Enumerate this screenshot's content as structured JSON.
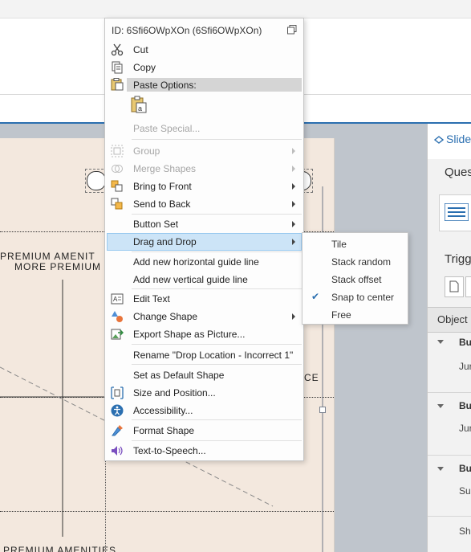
{
  "slide": {
    "text_premium_1": "PREMIUM AMENIT",
    "text_premium_2": "MORE PREMIUM",
    "text_ce": "CE",
    "text_premium_bottom": "PREMIUM AMENITIES"
  },
  "right_panel": {
    "slide_tab": "Slide",
    "question_label": "Ques",
    "triggers_label": "Trigg",
    "object_label": "Object",
    "bu_1": "Bu",
    "ju_1": "Jur",
    "bu_2": "Bu",
    "ju_2": "Jur",
    "bu_3": "Bu",
    "sub_1": "Sub",
    "sho_1": "Sho"
  },
  "context_menu": {
    "id_label": "ID: 6Sfi6OWpXOn  (6Sfi6OWpXOn)",
    "cut": "Cut",
    "copy": "Copy",
    "paste_options": "Paste Options:",
    "paste_special": "Paste Special...",
    "group": "Group",
    "merge_shapes": "Merge Shapes",
    "bring_to_front": "Bring to Front",
    "send_to_back": "Send to Back",
    "button_set": "Button Set",
    "drag_and_drop": "Drag and Drop",
    "add_h_guide": "Add new horizontal guide line",
    "add_v_guide": "Add new vertical guide line",
    "edit_text": "Edit Text",
    "change_shape": "Change Shape",
    "export_shape": "Export Shape as Picture...",
    "rename": "Rename \"Drop Location - Incorrect 1\"",
    "set_default": "Set as Default Shape",
    "size_position": "Size and Position...",
    "accessibility": "Accessibility...",
    "format_shape": "Format Shape",
    "tts": "Text-to-Speech..."
  },
  "submenu": {
    "tile": "Tile",
    "stack_random": "Stack random",
    "stack_offset": "Stack offset",
    "snap_to_center": "Snap to center",
    "free": "Free",
    "snap_checked": true
  },
  "colors": {
    "accent": "#2b6fb0",
    "highlight": "#cce4f7",
    "slide_bg": "#f3e8de"
  }
}
